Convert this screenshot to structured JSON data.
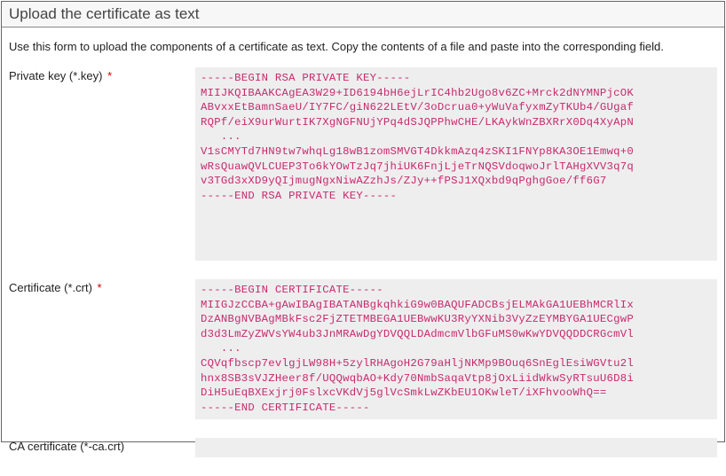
{
  "header": {
    "title": "Upload the certificate as text"
  },
  "description": "Use this form to upload the components of a certificate as text. Copy the contents of a file and paste into the corresponding field.",
  "fields": {
    "privateKey": {
      "label": "Private key (*.key)",
      "required": "*",
      "value": "-----BEGIN RSA PRIVATE KEY-----\nMIIJKQIBAAKCAgEA3W29+ID6194bH6ejLrIC4hb2Ugo8v6ZC+Mrck2dNYMNPjcOK\nABvxxEtBamnSaeU/IY7FC/giN622LEtV/3oDcrua0+yWuVafyxmZyTKUb4/GUgaf\nRQPf/eiX9urWurtIK7XgNGFNUjYPq4dSJQPPhwCHE/LKAykWnZBXRrX0Dq4XyApN\n   ...\nV1sCMYTd7HN9tw7whqLg18wB1zomSMVGT4DkkmAzq4zSKI1FNYp8KA3OE1Emwq+0\nwRsQuawQVLCUEP3To6kYOwTzJq7jhiUK6FnjLjeTrNQSVdoqwoJrlTAHgXVV3q7q\nv3TGd3xXD9yQIjmugNgxNiwAZzhJs/ZJy++fPSJ1XQxbd9qPghgGoe/ff6G7\n-----END RSA PRIVATE KEY-----"
    },
    "certificate": {
      "label": "Certificate (*.crt)",
      "required": "*",
      "value": "-----BEGIN CERTIFICATE-----\nMIIGJzCCBA+gAwIBAgIBATANBgkqhkiG9w0BAQUFADCBsjELMAkGA1UEBhMCRlIx\nDzANBgNVBAgMBkFsc2FjZTETMBEGA1UEBwwKU3RyYXNib3VyZzEYMBYGA1UECgwP\nd3d3LmZyZWVsYW4ub3JnMRAwDgYDVQQLDAdmcmVlbGFuMS0wKwYDVQQDDCRGcmVl\n   ...\nCQVqfbscp7evlgjLW98H+5zylRHAgoH2G79aHljNKMp9BOuq6SnEglEsiWGVtu2l\nhnx8SB3sVJZHeer8f/UQQwqbAO+Kdy70NmbSaqaVtp8jOxLiidWkwSyRTsuU6D8i\nDiH5uEqBXExjrj0FslxcVKdVj5glVcSmkLwZKbEU1OKwleT/iXFhvooWhQ==\n-----END CERTIFICATE-----"
    },
    "caCertificate": {
      "label": "CA certificate (*-ca.crt)",
      "value": ""
    }
  }
}
